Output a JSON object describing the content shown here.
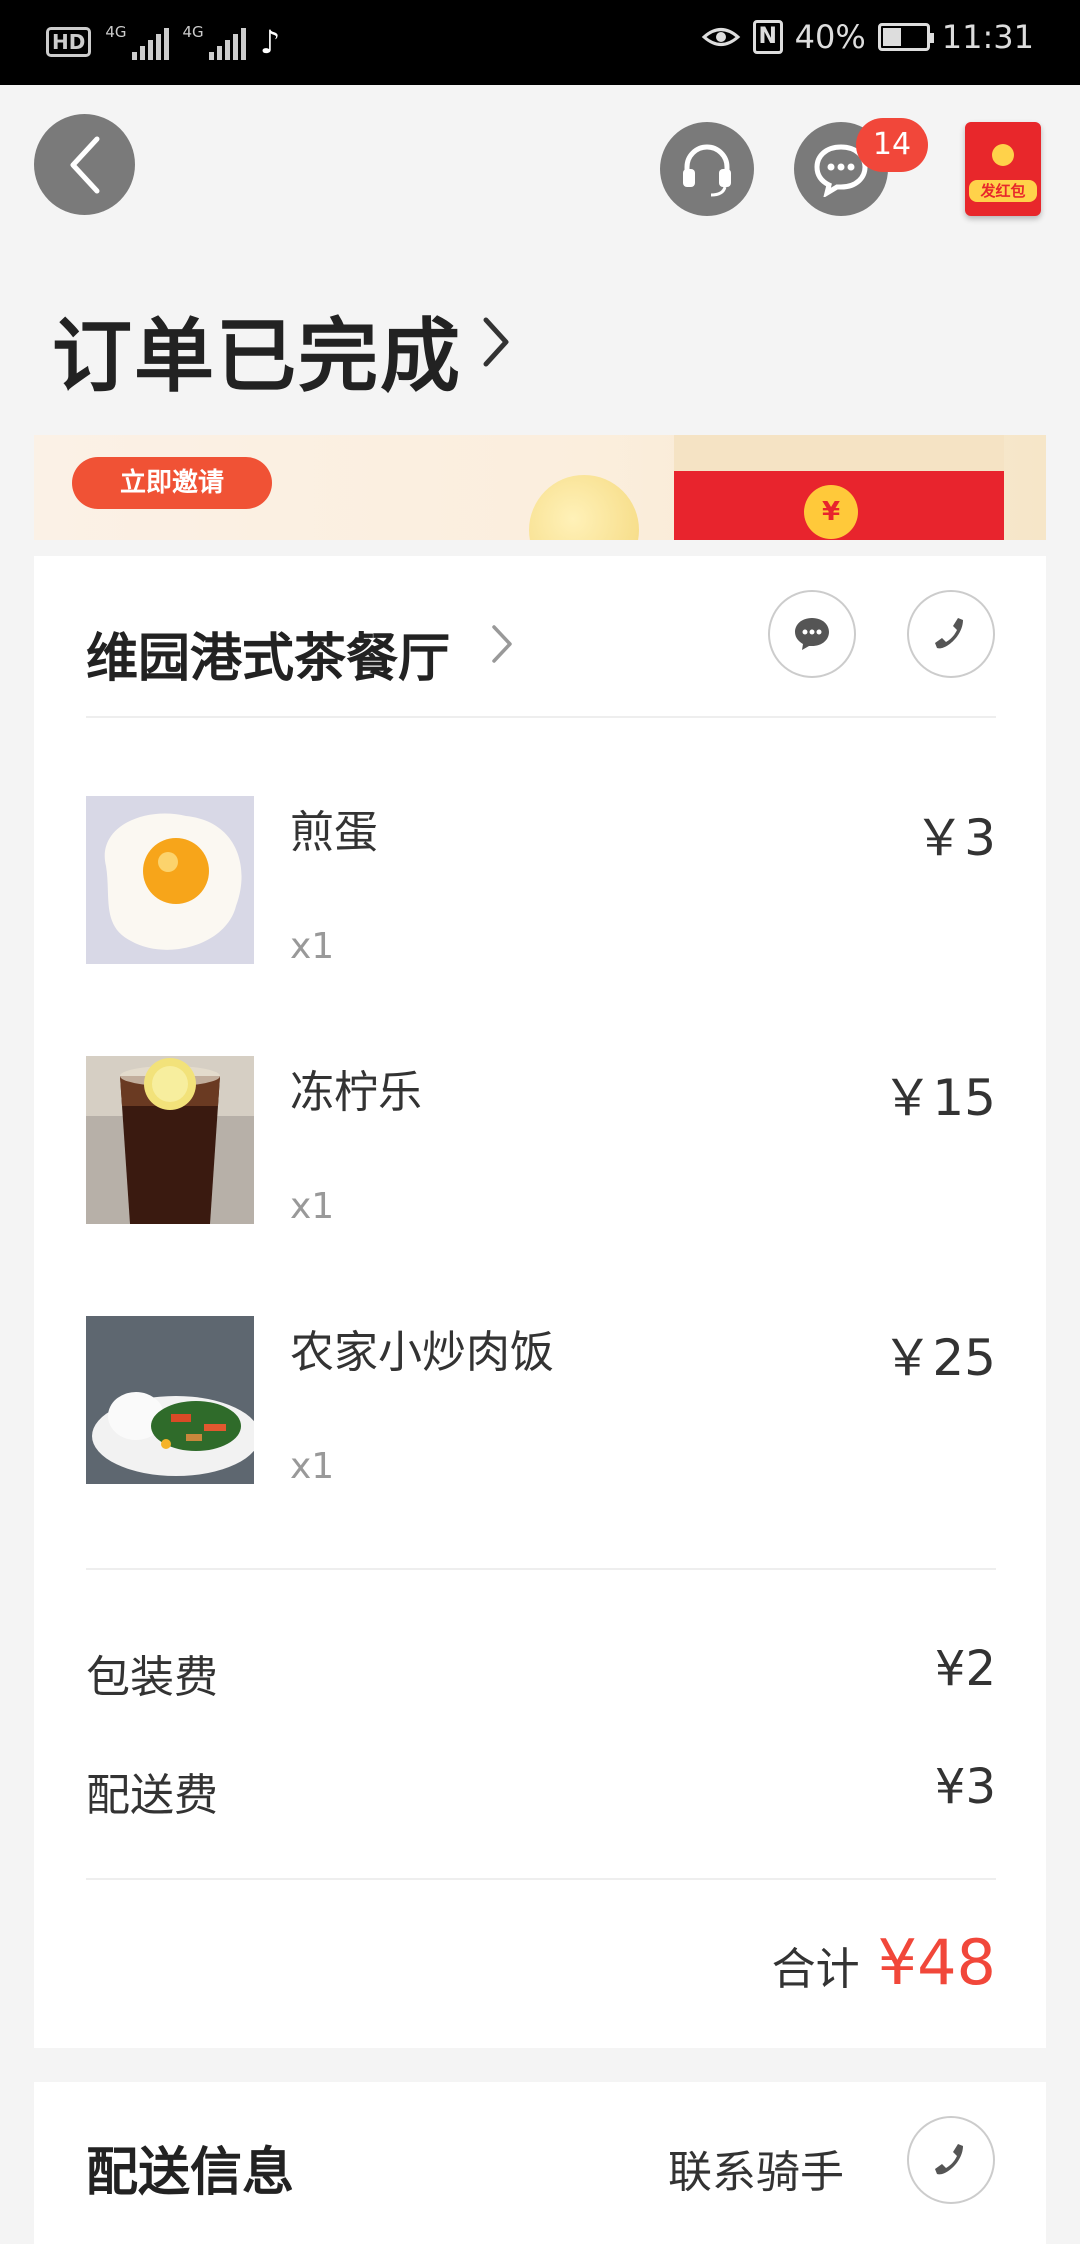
{
  "status_bar": {
    "hd": "HD",
    "net1": "4G",
    "net2": "4G",
    "battery_percent": "40%",
    "time": "11:31"
  },
  "header": {
    "message_badge": "14",
    "red_packet_label": "发红包"
  },
  "page": {
    "title": "订单已完成"
  },
  "banner": {
    "invite_label": "立即邀请",
    "coin_symbol": "¥"
  },
  "shop": {
    "name": "维园港式茶餐厅"
  },
  "items": [
    {
      "name": "煎蛋",
      "qty": "x1",
      "price": "￥3",
      "image": "fried-egg"
    },
    {
      "name": "冻柠乐",
      "qty": "x1",
      "price": "￥15",
      "image": "iced-lemon-cola"
    },
    {
      "name": "农家小炒肉饭",
      "qty": "x1",
      "price": "￥25",
      "image": "stir-fried-pork-rice"
    }
  ],
  "fees": {
    "packaging_label": "包装费",
    "packaging_value": "¥2",
    "delivery_label": "配送费",
    "delivery_value": "¥3"
  },
  "total": {
    "label": "合计",
    "value": "¥48"
  },
  "delivery": {
    "title": "配送信息",
    "contact_label": "联系骑手"
  },
  "colors": {
    "accent_red": "#f1473a",
    "background": "#f4f4f4",
    "icon_gray": "#7a7a7a"
  }
}
